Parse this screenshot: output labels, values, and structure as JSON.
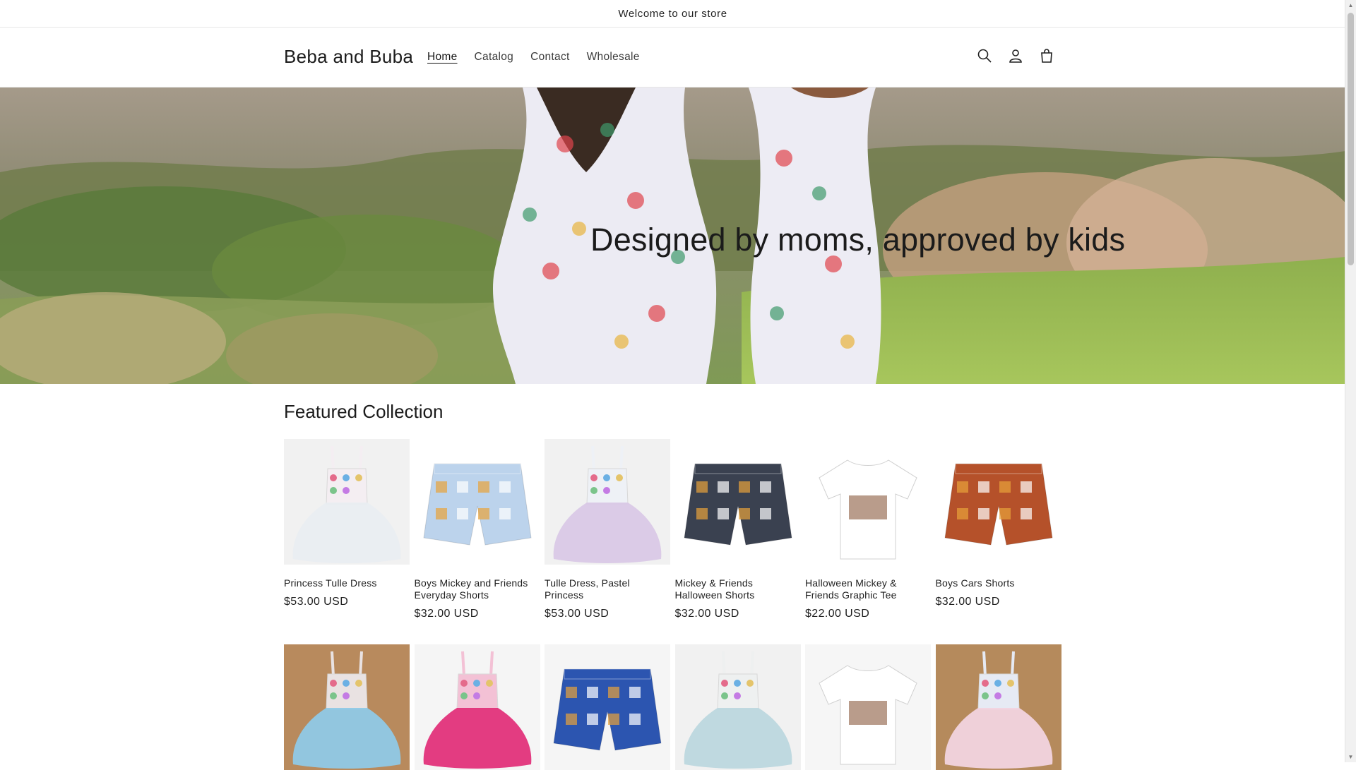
{
  "announcement": "Welcome to our store",
  "header": {
    "logo": "Beba and Buba",
    "nav": [
      {
        "label": "Home",
        "active": true
      },
      {
        "label": "Catalog",
        "active": false
      },
      {
        "label": "Contact",
        "active": false
      },
      {
        "label": "Wholesale",
        "active": false
      }
    ],
    "icons": [
      "search-icon",
      "account-icon",
      "cart-icon"
    ]
  },
  "hero": {
    "title": "Designed by moms, approved by kids"
  },
  "featured": {
    "title": "Featured Collection",
    "products": [
      {
        "title": "Princess Tulle Dress",
        "price": "$53.00 USD",
        "kind": "dress",
        "top": "#f4eef2",
        "skirt": "#e9edf1",
        "bg": "#f1f1f1"
      },
      {
        "title": "Boys Mickey and Friends Everyday Shorts",
        "price": "$32.00 USD",
        "kind": "shorts",
        "top": "#bcd3ec",
        "skirt": "#bcd3ec",
        "bg": "#ffffff"
      },
      {
        "title": "Tulle Dress, Pastel Princess",
        "price": "$53.00 USD",
        "kind": "dress",
        "top": "#eef1f6",
        "skirt": "#d9c8e6",
        "bg": "#f1f1f1"
      },
      {
        "title": "Mickey & Friends Halloween Shorts",
        "price": "$32.00 USD",
        "kind": "shorts",
        "top": "#3a4150",
        "skirt": "#3a4150",
        "bg": "#ffffff"
      },
      {
        "title": "Halloween Mickey & Friends Graphic Tee",
        "price": "$22.00 USD",
        "kind": "tee",
        "top": "#ffffff",
        "skirt": "#ffffff",
        "bg": "#ffffff"
      },
      {
        "title": "Boys Cars Shorts",
        "price": "$32.00 USD",
        "kind": "shorts",
        "top": "#b5512a",
        "skirt": "#b5512a",
        "bg": "#ffffff"
      },
      {
        "title": "",
        "price": "",
        "kind": "dress",
        "top": "#e9e2e2",
        "skirt": "#8fc9e6",
        "bg": "#b88a5d"
      },
      {
        "title": "",
        "price": "",
        "kind": "dress",
        "top": "#f3c1d5",
        "skirt": "#e2317a",
        "bg": "#f5f5f5"
      },
      {
        "title": "",
        "price": "",
        "kind": "shorts",
        "top": "#2c55b0",
        "skirt": "#2c55b0",
        "bg": "#f5f5f5"
      },
      {
        "title": "",
        "price": "",
        "kind": "dress",
        "top": "#eef0f0",
        "skirt": "#bcd7de",
        "bg": "#f1f1f1"
      },
      {
        "title": "",
        "price": "",
        "kind": "tee",
        "top": "#ffffff",
        "skirt": "#ffffff",
        "bg": "#f6f6f6"
      },
      {
        "title": "",
        "price": "",
        "kind": "dress",
        "top": "#e6eaf4",
        "skirt": "#f2d4df",
        "bg": "#b58a5c"
      }
    ]
  }
}
